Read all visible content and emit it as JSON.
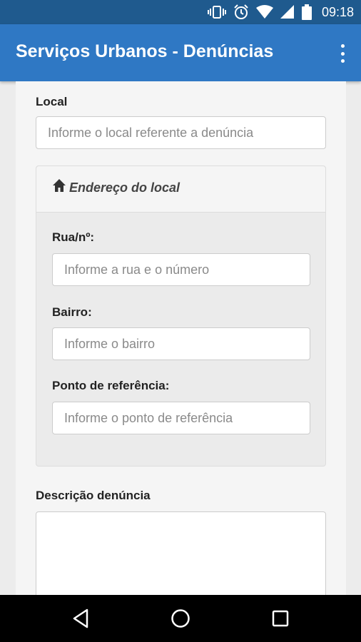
{
  "status_bar": {
    "time": "09:18",
    "icons": [
      "vibrate-icon",
      "alarm-icon",
      "wifi-icon",
      "signal-icon",
      "battery-icon"
    ]
  },
  "app_bar": {
    "title": "Serviços Urbanos - Denúncias",
    "menu_icon": "more-vert-icon"
  },
  "form": {
    "local": {
      "label": "Local",
      "placeholder": "Informe o local referente a denúncia",
      "value": ""
    },
    "address_panel": {
      "title": "Endereço do local",
      "icon": "home-icon",
      "street": {
        "label": "Rua/nº:",
        "placeholder": "Informe a rua e o número",
        "value": ""
      },
      "neighborhood": {
        "label": "Bairro:",
        "placeholder": "Informe o bairro",
        "value": ""
      },
      "reference": {
        "label": "Ponto de referência:",
        "placeholder": "Informe o ponto de referência",
        "value": ""
      }
    },
    "description": {
      "label": "Descrição denúncia",
      "value": ""
    }
  },
  "nav_bar": {
    "buttons": [
      "back-icon",
      "home-circle-icon",
      "recents-icon"
    ]
  },
  "colors": {
    "status_bar": "#1f5a8e",
    "app_bar": "#2f78c4",
    "content_bg": "#f5f5f5",
    "panel_bg": "#ebebeb"
  }
}
